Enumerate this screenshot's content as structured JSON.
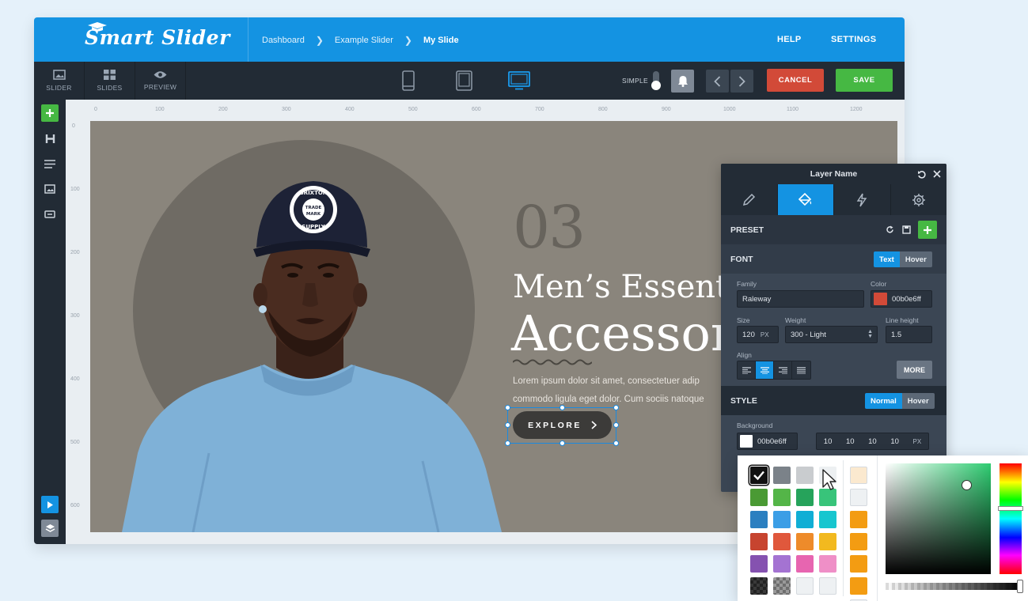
{
  "app": {
    "logo": "Smart Slider"
  },
  "breadcrumb": {
    "items": [
      "Dashboard",
      "Example Slider",
      "My Slide"
    ]
  },
  "header": {
    "help": "HELP",
    "settings": "SETTINGS"
  },
  "toolbar": {
    "tabs": [
      {
        "label": "SLIDER",
        "icon": "image-icon"
      },
      {
        "label": "SLIDES",
        "icon": "grid-icon"
      },
      {
        "label": "PREVIEW",
        "icon": "eye-icon"
      }
    ],
    "devices": [
      "mobile-icon",
      "tablet-icon",
      "desktop-icon"
    ],
    "active_device": "desktop",
    "simple_label": "SIMPLE",
    "cancel": "CANCEL",
    "save": "SAVE"
  },
  "sidebar": {
    "tools": [
      "add-layer-icon",
      "heading-icon",
      "text-icon",
      "image-icon",
      "button-icon"
    ],
    "bottom": [
      "play-icon",
      "layers-icon"
    ]
  },
  "rulers": {
    "top": [
      "0",
      "100",
      "200",
      "300",
      "400",
      "500",
      "600",
      "700",
      "800",
      "900",
      "1000",
      "1100",
      "1200"
    ],
    "left": [
      "0",
      "100",
      "200",
      "300",
      "400",
      "500",
      "600"
    ]
  },
  "slide": {
    "number": "03",
    "title_line1": "Men’s Essentia",
    "title_line2": "Accessor",
    "paragraph_line1": "Lorem ipsum dolor sit amet, consectetuer adip",
    "paragraph_line2": "commodo ligula eget dolor. Cum sociis natoque",
    "button": "EXPLORE",
    "cap_text": {
      "top": "BRIXTON",
      "mid1": "TRADE",
      "mid2": "MARK",
      "bottom": "SUPPLY"
    }
  },
  "layer_panel": {
    "title": "Layer Name",
    "tabs": [
      "pencil-icon",
      "paint-bucket-icon",
      "lightning-icon",
      "gear-icon"
    ],
    "active_tab": 1,
    "preset_label": "PRESET",
    "font": {
      "label": "FONT",
      "modes": [
        "Text",
        "Hover"
      ],
      "family_label": "Family",
      "family": "Raleway",
      "color_label": "Color",
      "color": "00b0e6ff",
      "color_swatch": "#d24a38",
      "size_label": "Size",
      "size": "120",
      "size_unit": "PX",
      "weight_label": "Weight",
      "weight": "300 - Light",
      "line_height_label": "Line height",
      "line_height": "1.5",
      "align_label": "Align",
      "align_active": 1,
      "more": "MORE"
    },
    "style": {
      "label": "STYLE",
      "modes": [
        "Normal",
        "Hover"
      ],
      "background_label": "Background",
      "background": "00b0e6ff",
      "padding": [
        "10",
        "10",
        "10",
        "10"
      ],
      "padding_unit": "PX"
    }
  },
  "color_picker": {
    "swatches": [
      [
        "#111111",
        "#7b8289",
        "#c9cccf",
        "#edf0f2"
      ],
      [
        "#4a9a34",
        "#54b548",
        "#26a35b",
        "#38c47a"
      ],
      [
        "#2b7fc0",
        "#3b9ee6",
        "#10aed5",
        "#17c6cf"
      ],
      [
        "#c7442f",
        "#e0583c",
        "#ee8b2a",
        "#f2b91f"
      ],
      [
        "#8552b0",
        "#a473d2",
        "#e765b0",
        "#ef8fc7"
      ],
      [
        "#2a2a2a",
        "#7e7e7e",
        "#eef1f3",
        "#eef1f3"
      ]
    ],
    "extra": [
      "#fbe9cf",
      "#eef1f3",
      "#f39c12",
      "#f39c12",
      "#f39c12",
      "#f39c12",
      "#eef1f3"
    ],
    "selected": "#111111",
    "hue": "#2ecc71"
  }
}
